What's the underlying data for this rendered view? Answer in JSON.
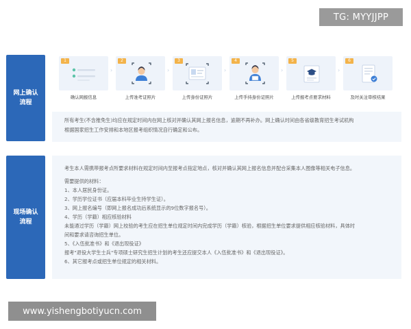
{
  "watermarks": {
    "top": "TG: MYYJJPP",
    "bottom": "www.yishengbotiyucn.com"
  },
  "online": {
    "label": "网上确认流程",
    "steps": [
      {
        "num": "1",
        "label": "确认网报信息",
        "icon": "form-check-icon"
      },
      {
        "num": "2",
        "label": "上传准考证照片",
        "icon": "portrait-frame-icon"
      },
      {
        "num": "3",
        "label": "上传身份证照片",
        "icon": "id-card-icon"
      },
      {
        "num": "4",
        "label": "上传手持身份证照片",
        "icon": "person-holding-id-icon"
      },
      {
        "num": "5",
        "label": "上传报考点要求材料",
        "icon": "graduation-cap-icon"
      },
      {
        "num": "6",
        "label": "及时关注审核结果",
        "icon": "document-check-icon"
      }
    ],
    "note_lines": [
      "所有考生(不含推免生)均应在规定时间内在网上核对并确认其网上报名信息，逾期不再补办。网上确认时间由各省级教育招生考试机构",
      "根据国家招生工作安排和本地区报考组织情况自行确定和公布。"
    ]
  },
  "onsite": {
    "label": "现场确认流程",
    "intro": "考生本人需携带报考点所要求材料在规定时间内至报考点指定地点，核对并确认其网上报名信息并配合采集本人图像等相关电子信息。",
    "lines": [
      "需要提供的材料：",
      "1、本人居民身份证。",
      "2、学历学位证书（应届本科毕业生持学生证）。",
      "3、网上报名编号（即网上报名成功后系统显示的9位数字报名号）。",
      "4、学历（学籍）相应核验材料",
      "未能通过学历（学籍）网上校验的考生应在招生单位规定时间内完成学历（学籍）核验，根据招生单位要求提供相应核验材料，具体时",
      "间和要求请咨询招生单位。",
      "5、《入伍批准书》和《退出现役证》",
      "报考\"退役大学生士兵\"专项硕士研究生招生计划的考生还应提交本人《入伍批准书》和《退出现役证》。",
      "6、其它报考点或招生单位规定的相关材料。"
    ]
  },
  "colors": {
    "label_bg": "#2c68b8",
    "step_badge": "#f3b34a",
    "panel_bg": "#f2f6fb"
  }
}
